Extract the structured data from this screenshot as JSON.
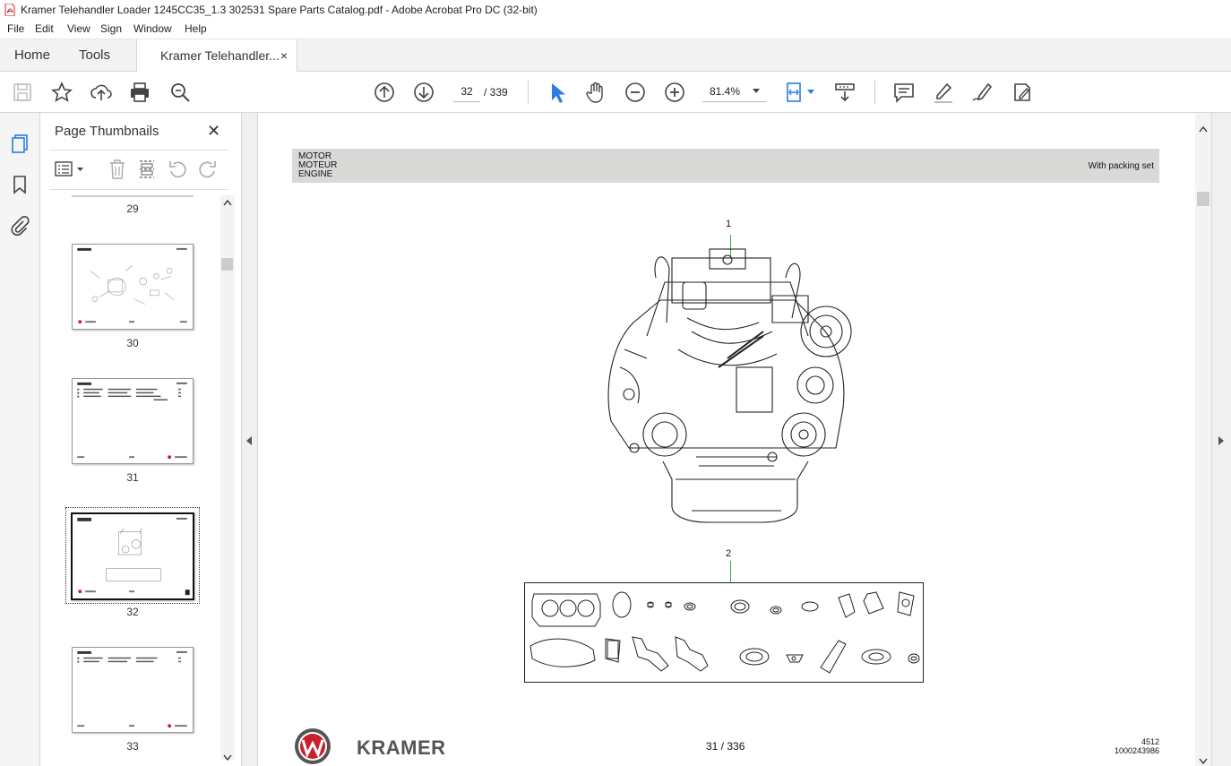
{
  "window": {
    "title": "Kramer Telehandler Loader 1245CC35_1.3 302531 Spare Parts Catalog.pdf - Adobe Acrobat Pro DC (32-bit)"
  },
  "menu": [
    "File",
    "Edit",
    "View",
    "Sign",
    "Window",
    "Help"
  ],
  "tabs": {
    "home": "Home",
    "tools": "Tools",
    "document": "Kramer Telehandler...",
    "close": "×"
  },
  "toolbar": {
    "page_current": "32",
    "page_total": "/  339",
    "zoom": "81.4%"
  },
  "thumbnails_panel": {
    "title": "Page Thumbnails",
    "close": "✕",
    "pages": [
      "29",
      "30",
      "31",
      "32",
      "33"
    ],
    "selected": "32"
  },
  "document": {
    "header_lines": [
      "MOTOR",
      "MOTEUR",
      "ENGINE"
    ],
    "header_right": "With packing set",
    "callouts": [
      "1",
      "2"
    ],
    "footer_brand": "KRAMER",
    "footer_page": "31 / 336",
    "footer_code_1": "4512",
    "footer_code_2": "1000243986"
  },
  "colors": {
    "accent_blue": "#2b7de1",
    "leader_green": "#2fae3a",
    "header_gray": "#d9d9d8",
    "kramer_red": "#c8202f"
  }
}
